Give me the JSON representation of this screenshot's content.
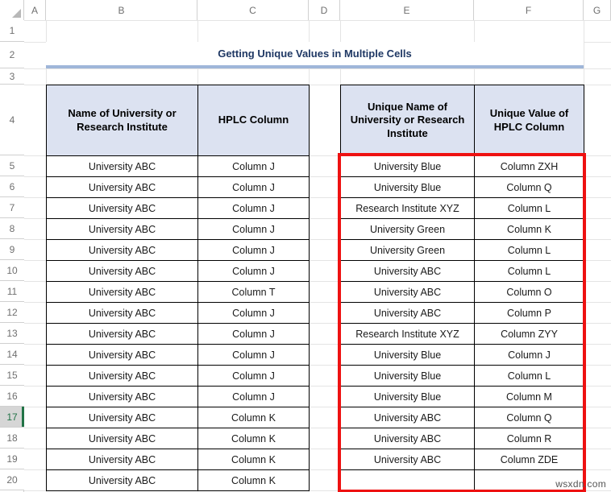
{
  "app": {
    "type": "spreadsheet",
    "watermark": "wsxdn.com",
    "selected_row": "17",
    "accent_selection_color": "#217346",
    "header_fill_color": "#dce2f1",
    "title_underline_color": "#9fb6d9",
    "highlight_box_color": "#ee1111"
  },
  "column_headers": [
    "A",
    "B",
    "C",
    "D",
    "E",
    "F",
    "G"
  ],
  "row_headers": [
    "1",
    "2",
    "3",
    "4",
    "5",
    "6",
    "7",
    "8",
    "9",
    "10",
    "11",
    "12",
    "13",
    "14",
    "15",
    "16",
    "17",
    "18",
    "19",
    "20"
  ],
  "title": {
    "text": "Getting Unique Values in Multiple Cells"
  },
  "source_table": {
    "headers": [
      "Name of University or Research Institute",
      "HPLC Column"
    ],
    "rows": [
      [
        "University ABC",
        "Column J"
      ],
      [
        "University ABC",
        "Column J"
      ],
      [
        "University ABC",
        "Column J"
      ],
      [
        "University ABC",
        "Column J"
      ],
      [
        "University ABC",
        "Column J"
      ],
      [
        "University ABC",
        "Column J"
      ],
      [
        "University ABC",
        "Column T"
      ],
      [
        "University ABC",
        "Column J"
      ],
      [
        "University ABC",
        "Column J"
      ],
      [
        "University ABC",
        "Column J"
      ],
      [
        "University ABC",
        "Column J"
      ],
      [
        "University ABC",
        "Column J"
      ],
      [
        "University ABC",
        "Column K"
      ],
      [
        "University ABC",
        "Column K"
      ],
      [
        "University ABC",
        "Column K"
      ],
      [
        "University ABC",
        "Column K"
      ]
    ]
  },
  "result_table": {
    "headers": [
      "Unique Name of University or Research Institute",
      "Unique Value of HPLC Column"
    ],
    "rows": [
      [
        "University Blue",
        "Column ZXH"
      ],
      [
        "University Blue",
        "Column Q"
      ],
      [
        "Research Institute XYZ",
        "Column L"
      ],
      [
        "University Green",
        "Column K"
      ],
      [
        "University Green",
        "Column L"
      ],
      [
        "University ABC",
        "Column L"
      ],
      [
        "University ABC",
        "Column O"
      ],
      [
        "University ABC",
        "Column P"
      ],
      [
        "Research Institute XYZ",
        "Column ZYY"
      ],
      [
        "University Blue",
        "Column J"
      ],
      [
        "University Blue",
        "Column L"
      ],
      [
        "University Blue",
        "Column M"
      ],
      [
        "University ABC",
        "Column Q"
      ],
      [
        "University ABC",
        "Column R"
      ],
      [
        "University ABC",
        "Column ZDE"
      ],
      [
        "",
        ""
      ]
    ]
  }
}
